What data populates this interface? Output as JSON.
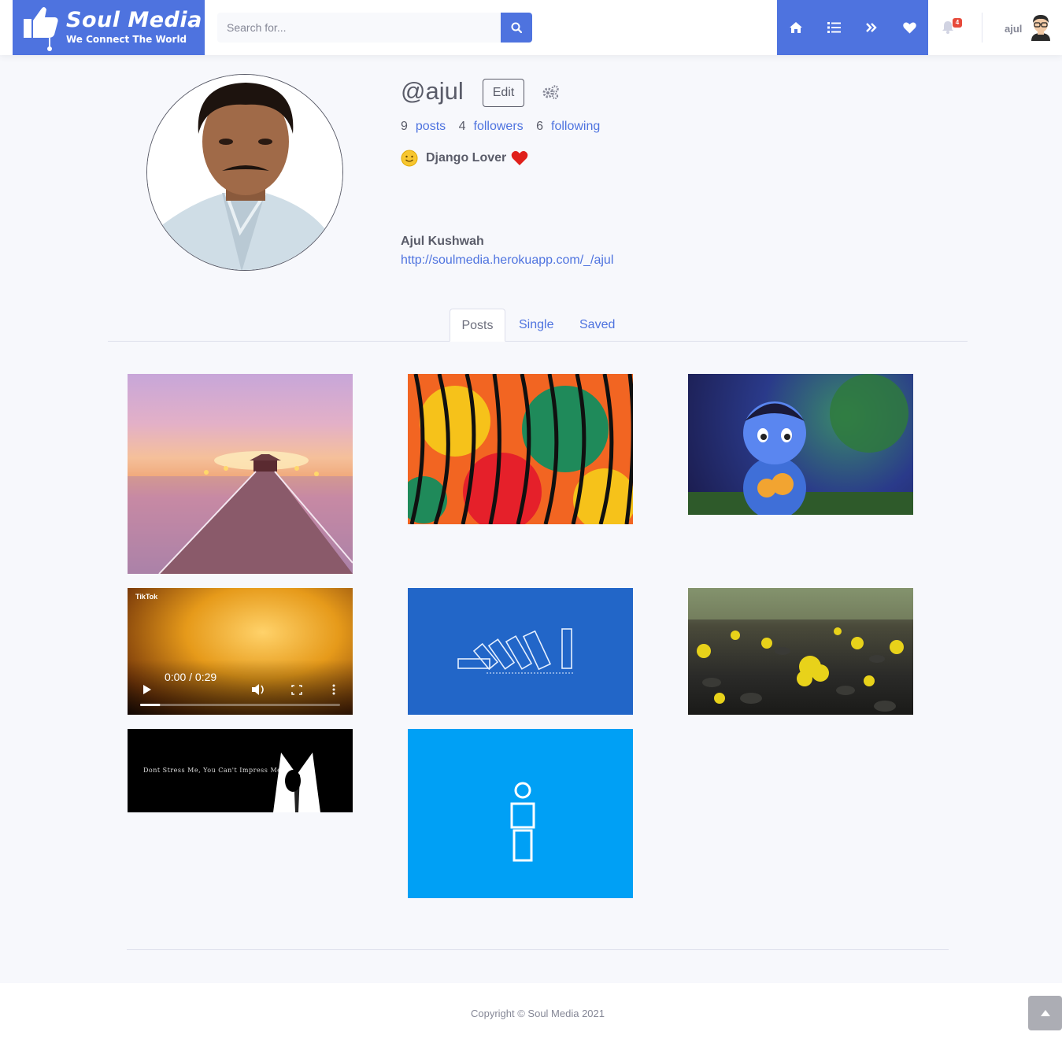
{
  "brand": {
    "name": "Soul Media",
    "tagline": "We Connect The World",
    "color": "#4e73df"
  },
  "search": {
    "placeholder": "Search for..."
  },
  "nav": {
    "icons": [
      "home-icon",
      "list-icon",
      "double-chevron-icon",
      "heart-icon"
    ],
    "notifications_count": "4",
    "username": "ajul"
  },
  "profile": {
    "handle": "@ajul",
    "edit_label": "Edit",
    "posts_count": "9",
    "posts_label": "posts",
    "followers_count": "4",
    "followers_label": "followers",
    "following_count": "6",
    "following_label": "following",
    "bio": "Django Lover",
    "full_name": "Ajul Kushwah",
    "link": "http://soulmedia.herokuapp.com/_/ajul"
  },
  "tabs": [
    {
      "label": "Posts",
      "active": true
    },
    {
      "label": "Single",
      "active": false
    },
    {
      "label": "Saved",
      "active": false
    }
  ],
  "posts": {
    "video": {
      "source_badge": "TikTok",
      "time": "0:00 / 0:29",
      "progress": 0.1
    },
    "quote_text": "Dont Stress Me, You Can't Impress Me.."
  },
  "footer": {
    "copyright": "Copyright © Soul Media 2021"
  }
}
